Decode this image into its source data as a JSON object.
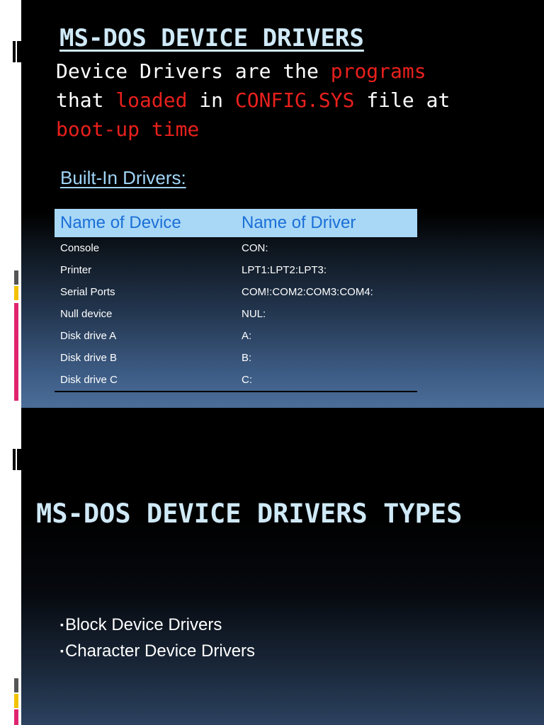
{
  "slide1": {
    "title": "MS-DOS DEVICE DRIVERS",
    "intro": {
      "t1": "Device Drivers are the ",
      "r1": "programs",
      "t2": "that ",
      "r2": "loaded",
      "t3": " in ",
      "r3": "CONFIG.SYS",
      "t4": " file at",
      "r4": "boot-up time"
    },
    "section_title": "Built-In Drivers:",
    "table": {
      "headers": [
        "Name of  Device",
        "Name of Driver"
      ],
      "rows": [
        [
          "Console",
          "CON:"
        ],
        [
          "Printer",
          "LPT1:LPT2:LPT3:"
        ],
        [
          "Serial Ports",
          "COM!:COM2:COM3:COM4:"
        ],
        [
          "Null device",
          "NUL:"
        ],
        [
          "Disk drive A",
          "A:"
        ],
        [
          "Disk drive B",
          "B:"
        ],
        [
          "Disk drive C",
          "C:"
        ]
      ]
    }
  },
  "slide2": {
    "title": "MS-DOS DEVICE DRIVERS TYPES",
    "bullet_symbol": "▪",
    "bullets": [
      "Block Device Drivers",
      "Character Device Drivers"
    ]
  },
  "colors": {
    "title": "#cfe9f7",
    "highlight_red": "#e8201c",
    "header_bg": "#a9d8f7",
    "header_text": "#1b6fd6",
    "accent_yellow": "#f2c200",
    "accent_magenta": "#e0236f"
  }
}
